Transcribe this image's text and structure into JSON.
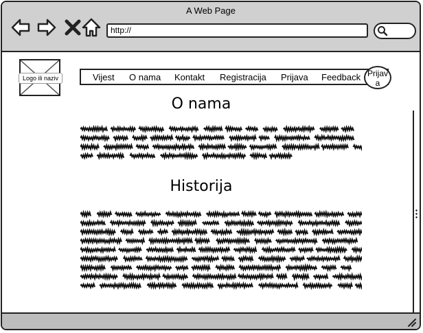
{
  "window": {
    "title": "A Web Page"
  },
  "browser": {
    "url": "http://",
    "icons": [
      "back-arrow-icon",
      "forward-arrow-icon",
      "close-x-icon",
      "home-icon",
      "search-icon"
    ]
  },
  "logo": {
    "label": "Logo ili naziv"
  },
  "menu": {
    "items": [
      {
        "label": "Vijest"
      },
      {
        "label": "O nama"
      },
      {
        "label": "Kontakt"
      },
      {
        "label": "Registracija"
      },
      {
        "label": "Prijava"
      },
      {
        "label": "Feedback"
      },
      {
        "label": "Prijava"
      }
    ]
  },
  "sections": [
    {
      "title": "O nama"
    },
    {
      "title": "Historija"
    }
  ],
  "colors": {
    "titlebar": "#d0d0d0",
    "statusbar": "#bdbdbd",
    "ink": "#222222"
  }
}
